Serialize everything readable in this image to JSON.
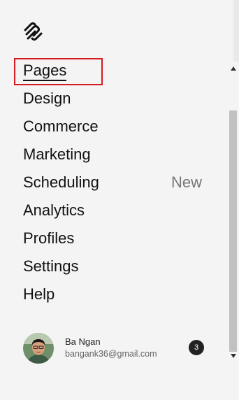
{
  "nav": {
    "items": [
      {
        "label": "Pages"
      },
      {
        "label": "Design"
      },
      {
        "label": "Commerce"
      },
      {
        "label": "Marketing"
      },
      {
        "label": "Scheduling",
        "badge": "New"
      },
      {
        "label": "Analytics"
      },
      {
        "label": "Profiles"
      },
      {
        "label": "Settings"
      },
      {
        "label": "Help"
      }
    ]
  },
  "account": {
    "name": "Ba Ngan",
    "email": "bangank36@gmail.com",
    "notifications": "3"
  },
  "colors": {
    "highlight": "#d61a20",
    "badge": "#777777",
    "notification_bg": "#222222"
  },
  "icons": [
    "squarespace-logo-icon",
    "scroll-up-icon",
    "scroll-down-icon"
  ]
}
